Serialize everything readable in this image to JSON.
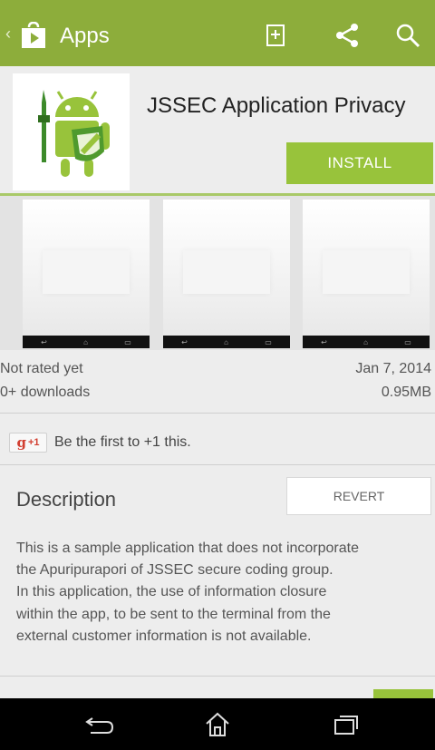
{
  "action_bar": {
    "title": "Apps",
    "up_icon": "chevron-left-icon",
    "logo_icon": "play-store-bag-icon",
    "icons": [
      "wishlist-add-icon",
      "share-icon",
      "search-icon"
    ],
    "background": "#8dad3b"
  },
  "app": {
    "name": "JSSEC Application Privacy",
    "icon": "android-shield-icon",
    "install_label": "INSTALL",
    "accent": "#98c33b"
  },
  "screenshots": {
    "count": 3
  },
  "stats": {
    "rating": "Not rated yet",
    "downloads": "0+ downloads",
    "date": "Jan 7, 2014",
    "size": "0.95MB"
  },
  "plus_one": {
    "g_label": "g",
    "plus_label": "+1",
    "text": "Be the first to +1 this."
  },
  "description": {
    "title": "Description",
    "revert_label": "REVERT",
    "lines": [
      "This is a sample application that does not incorporate",
      "the Apuripurapori of JSSEC secure coding group.",
      "In this application, the use of information closure",
      "within the app, to be sent to the terminal from the",
      "external customer information is not available."
    ]
  },
  "system_nav": {
    "icons": [
      "back-icon",
      "home-icon",
      "recents-icon"
    ]
  }
}
